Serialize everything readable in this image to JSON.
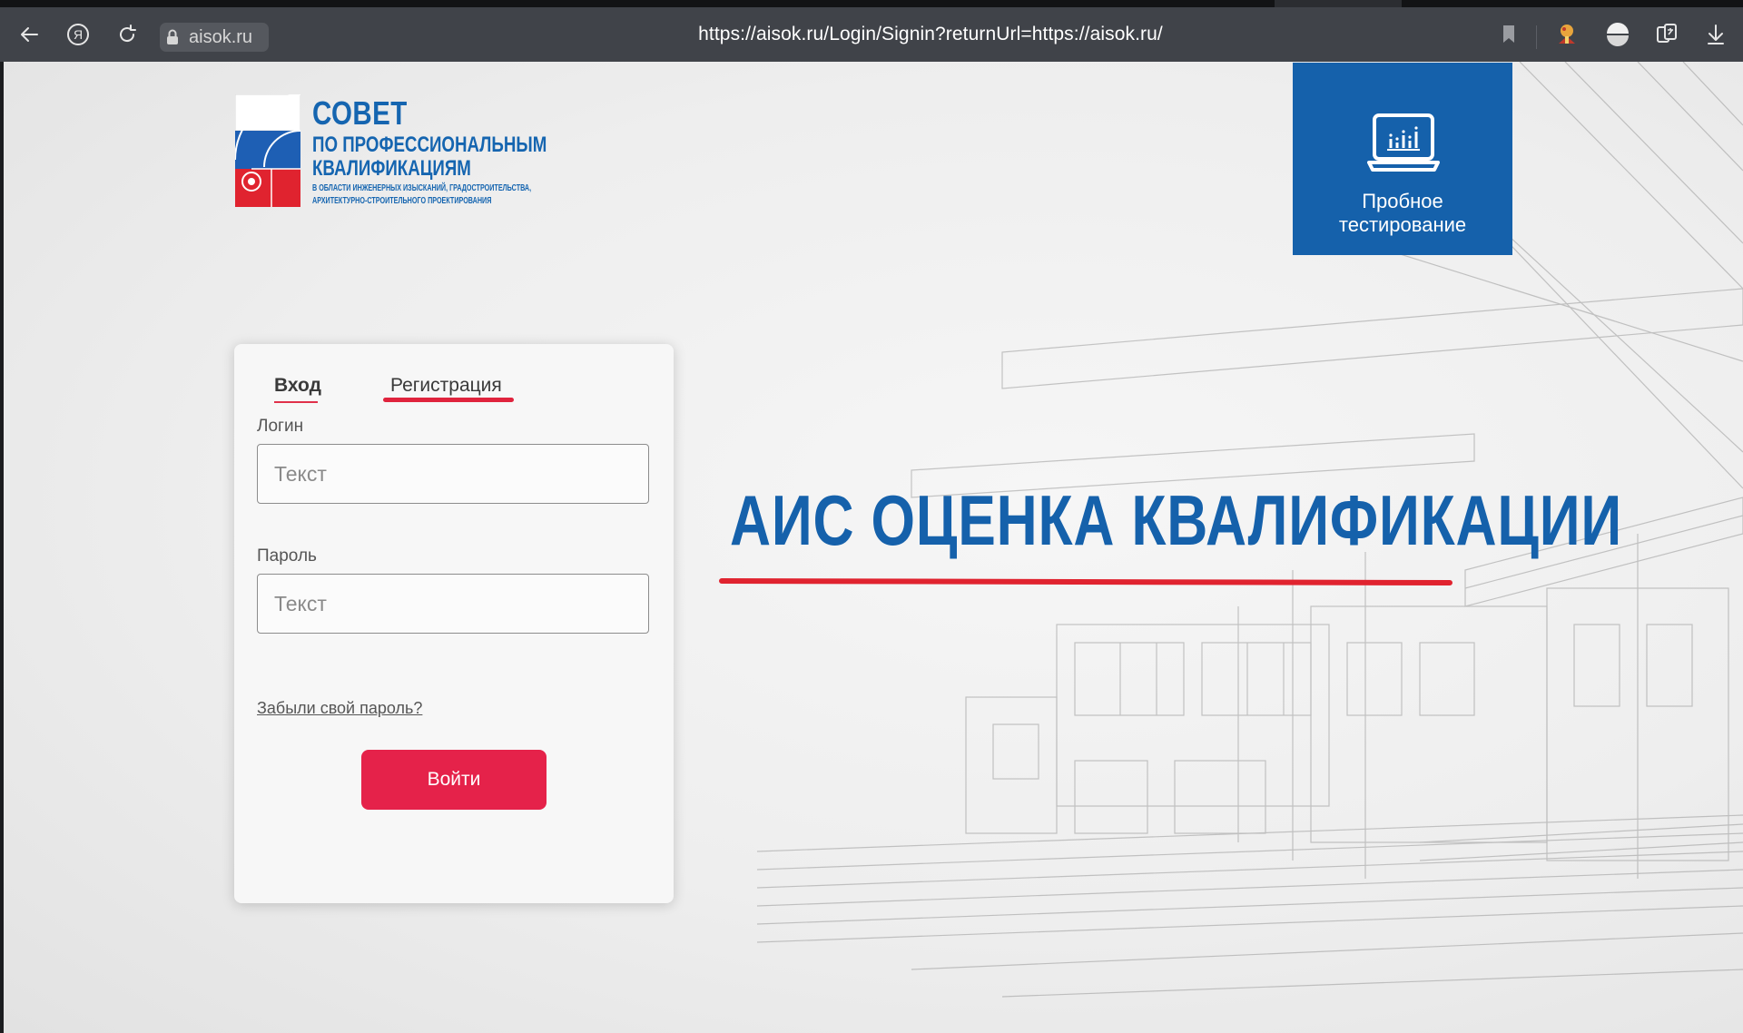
{
  "browser": {
    "domain_chip": "aisok.ru",
    "url": "https://aisok.ru/Login/Signin?returnUrl=https://aisok.ru/",
    "icons": [
      "back-arrow-icon",
      "yandex-icon",
      "reload-icon",
      "lock-icon",
      "bookmark-icon",
      "extension-icon",
      "vpn-icon",
      "translate-icon",
      "download-icon"
    ]
  },
  "logo": {
    "line1": "СОВЕТ",
    "line2": "ПО ПРОФЕССИОНАЛЬНЫМ",
    "line3": "КВАЛИФИКАЦИЯМ",
    "line4": "В ОБЛАСТИ ИНЖЕНЕРНЫХ ИЗЫСКАНИЙ, ГРАДОСТРОИТЕЛЬСТВА,",
    "line5": "АРХИТЕКТУРНО-СТРОИТЕЛЬНОГО ПРОЕКТИРОВАНИЯ"
  },
  "trial": {
    "line1": "Пробное",
    "line2": "тестирование"
  },
  "login_form": {
    "tab_login": "Вход",
    "tab_register": "Регистрация",
    "login_label": "Логин",
    "login_placeholder": "Текст",
    "password_label": "Пароль",
    "password_placeholder": "Текст",
    "forgot_link": "Забыли свой пароль?",
    "submit": "Войти"
  },
  "headline": "АИС ОЦЕНКА КВАЛИФИКАЦИИ",
  "colors": {
    "brand_blue": "#1561ab",
    "accent_red": "#e5224a",
    "toolbar": "#404349"
  }
}
